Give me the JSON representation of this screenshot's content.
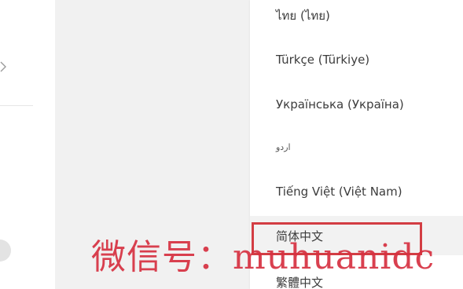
{
  "language_menu": {
    "items": [
      {
        "label": "ไทย (ไทย)"
      },
      {
        "label": "Türkçe (Türkiye)"
      },
      {
        "label": "Українська (Україна)"
      },
      {
        "label": "اردو"
      },
      {
        "label": "Tiếng Việt (Việt Nam)"
      },
      {
        "label": "简体中文"
      },
      {
        "label": "繁體中文"
      }
    ],
    "selected_label": "简体中文"
  },
  "watermark": {
    "text": "微信号：muhuanidc"
  },
  "colors": {
    "highlight_border": "#d33d43",
    "watermark": "#d63040",
    "gutter": "#f1f1f1",
    "menu_text": "#3c3c3c"
  },
  "icons": {
    "left_chevron": "chevron-right-icon",
    "left_toggle": "toggle-switch"
  }
}
